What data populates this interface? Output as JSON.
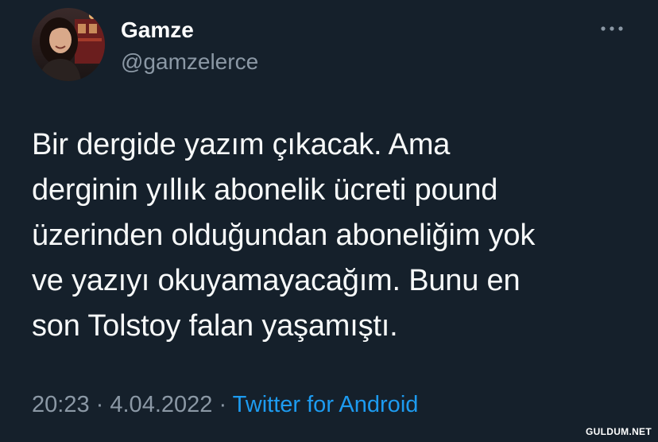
{
  "author": {
    "display_name": "Gamze",
    "handle": "@gamzelerce",
    "avatar_icon": "profile-photo"
  },
  "tweet": {
    "lines": [
      "Bir dergide yazım çıkacak. Ama",
      "derginin yıllık abonelik ücreti pound",
      "üzerinden olduğundan aboneliğim yok",
      "ve yazıyı okuyamayacağım. Bunu en",
      "son Tolstoy falan yaşamıştı."
    ]
  },
  "meta": {
    "time": "20:23",
    "separator": "·",
    "date": "4.04.2022",
    "source": "Twitter for Android"
  },
  "more_icon": "more-dots-icon",
  "watermark": "GULDUM.NET",
  "colors": {
    "background": "#15202b",
    "text": "#f7f9f9",
    "secondary": "#8b98a5",
    "link": "#1d9bf0"
  }
}
